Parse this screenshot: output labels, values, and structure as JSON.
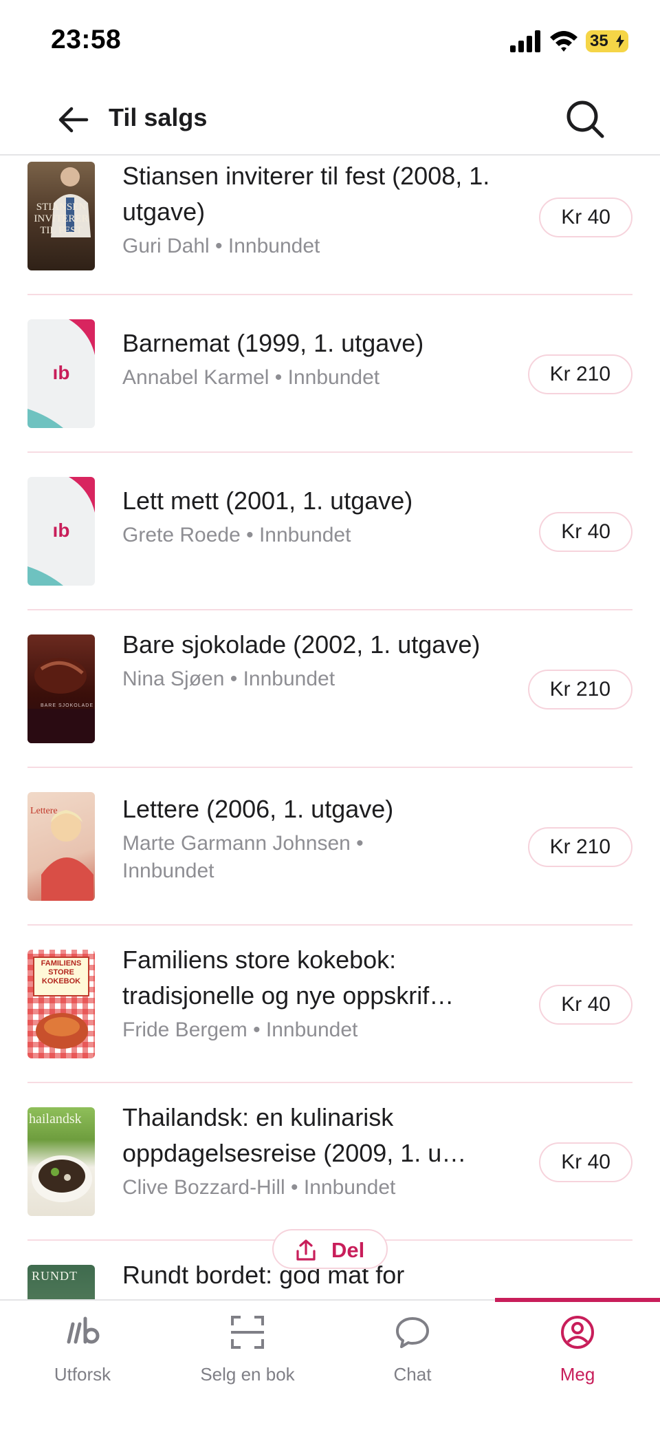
{
  "status": {
    "time": "23:58",
    "battery": "35"
  },
  "header": {
    "title": "Til salgs"
  },
  "items": [
    {
      "title": "Stiansen inviterer til fest (2008, 1. utgave)",
      "meta": "Guri Dahl • Innbundet",
      "price": "Kr 40",
      "cover_text": "STIANSEN INVITERER TIL FEST"
    },
    {
      "title": "Barnemat (1999, 1. utgave)",
      "meta": "Annabel Karmel • Innbundet",
      "price": "Kr 210",
      "cover_text": "ıb"
    },
    {
      "title": "Lett mett (2001, 1. utgave)",
      "meta": "Grete Roede • Innbundet",
      "price": "Kr 40",
      "cover_text": "ıb"
    },
    {
      "title": "Bare sjokolade (2002, 1. utgave)",
      "meta": "Nina Sjøen • Innbundet",
      "price": "Kr 210",
      "cover_text": "BARE SJOKOLADE"
    },
    {
      "title": "Lettere (2006, 1. utgave)",
      "meta": "Marte Garmann Johnsen • Innbundet",
      "price": "Kr 210",
      "cover_text": "Lettere"
    },
    {
      "title": "Familiens store kokebok: tradisjonelle og nye oppskrif…",
      "meta": "Fride Bergem • Innbundet",
      "price": "Kr 40",
      "cover_text": "FAMILIENS STORE KOKEBOK"
    },
    {
      "title": "Thailandsk: en kulinarisk oppdagelsesreise (2009, 1. u…",
      "meta": "Clive Bozzard-Hill • Innbundet",
      "price": "Kr 40",
      "cover_text": "hailandsk"
    },
    {
      "title": "Rundt bordet: god mat for",
      "meta": "",
      "price": "",
      "cover_text": "RUNDT"
    }
  ],
  "share": {
    "label": "Del"
  },
  "tabs": [
    {
      "label": "Utforsk",
      "icon": "logo-icon"
    },
    {
      "label": "Selg en bok",
      "icon": "scan-icon"
    },
    {
      "label": "Chat",
      "icon": "chat-icon"
    },
    {
      "label": "Meg",
      "icon": "profile-icon",
      "active": true
    }
  ],
  "colors": {
    "accent": "#c81e5a",
    "divider": "#f7dbe2",
    "muted": "#8e8e93"
  }
}
